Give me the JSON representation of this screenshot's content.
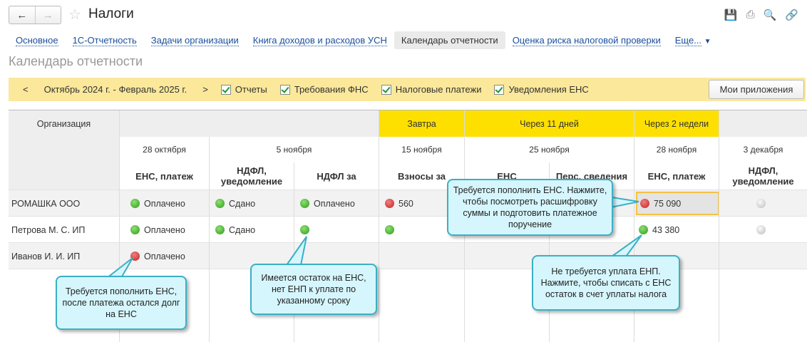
{
  "header": {
    "title": "Налоги",
    "back": "←",
    "forward": "→"
  },
  "tabs": [
    "Основное",
    "1С-Отчетность",
    "Задачи организации",
    "Книга доходов и расходов УСН",
    "Календарь отчетности",
    "Оценка риска налоговой проверки",
    "Еще..."
  ],
  "section_title": "Календарь отчетности",
  "filter": {
    "prev": "<",
    "next": ">",
    "period": "Октябрь 2024 г. - Февраль 2025 г.",
    "checks": [
      "Отчеты",
      "Требования ФНС",
      "Налоговые платежи",
      "Уведомления ЕНС"
    ],
    "my_apps": "Мои приложения"
  },
  "table": {
    "org_header": "Организация",
    "groups": [
      "Завтра",
      "Через 11 дней",
      "Через 2 недели"
    ],
    "dates": [
      "28 октября",
      "5 ноября",
      "15 ноября",
      "25 ноября",
      "28 ноября",
      "3 декабря"
    ],
    "columns": [
      "ЕНС, платеж",
      "НДФЛ, уведомление",
      "НДФЛ за",
      "Взносы за",
      "ЕНС",
      "Перс. сведения",
      "ЕНС, платеж",
      "НДФЛ, уведомление"
    ],
    "rows": [
      {
        "org": "РОМАШКА ООО",
        "c1": "Оплачено",
        "c2": "Сдано",
        "c3": "Оплачено",
        "c4": "560",
        "c7": "75 090"
      },
      {
        "org": "Петрова М. С. ИП",
        "c1": "Оплачено",
        "c2": "Сдано",
        "c7": "43 380"
      },
      {
        "org": "Иванов И. И. ИП",
        "c1": "Оплачено"
      }
    ]
  },
  "callouts": [
    "Требуется пополнить ЕНС. Нажмите, чтобы посмотреть расшифровку суммы и подготовить платежное поручение",
    "Требуется пополнить ЕНС, после платежа остался долг на ЕНС",
    "Имеется остаток на ЕНС, нет ЕНП к уплате по указанному сроку",
    "Не требуется уплата ЕНП. Нажмите, чтобы списать с ЕНС остаток в счет уплаты налога"
  ]
}
